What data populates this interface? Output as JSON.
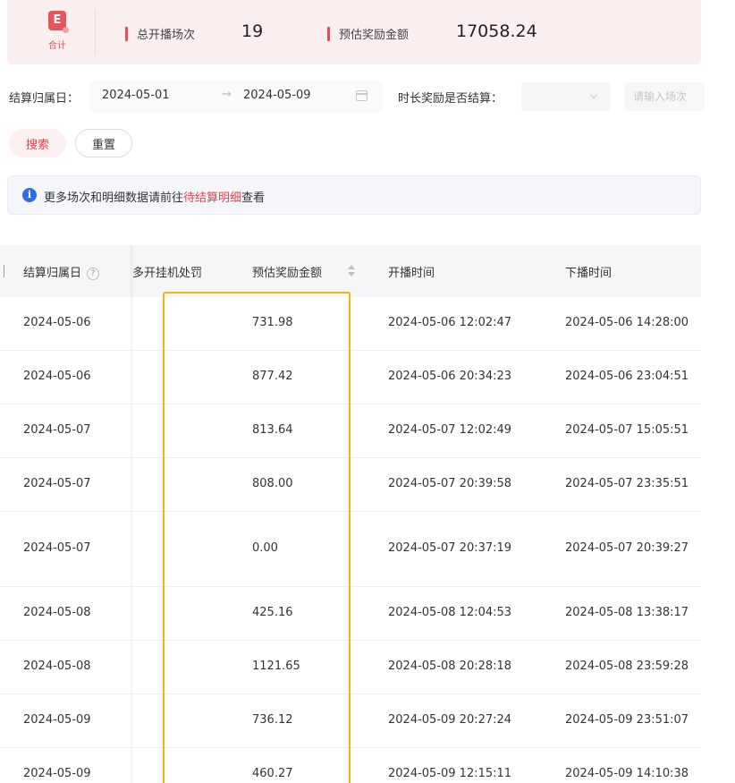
{
  "summary": {
    "badge_label": "合计",
    "total_sessions_label": "总开播场次",
    "total_sessions_value": "19",
    "estimated_reward_label": "预估奖励金额",
    "estimated_reward_value": "17058.24"
  },
  "filter": {
    "date_label": "结算归属日：",
    "start_date": "2024-05-01",
    "end_date": "2024-05-09",
    "duration_label": "时长奖励是否结算：",
    "input_placeholder": "请输入场次"
  },
  "buttons": {
    "search": "搜索",
    "reset": "重置"
  },
  "notice": {
    "text_before": "更多场次和明细数据请前往",
    "link": "待结算明细",
    "text_after": "查看"
  },
  "table": {
    "columns": [
      "结算归属日",
      "多开挂机处罚",
      "预估奖励金额",
      "开播时间",
      "下播时间"
    ],
    "rows": [
      [
        "2024-05-06",
        "",
        "731.98",
        "2024-05-06 12:02:47",
        "2024-05-06 14:28:00"
      ],
      [
        "2024-05-06",
        "",
        "877.42",
        "2024-05-06 20:34:23",
        "2024-05-06 23:04:51"
      ],
      [
        "2024-05-07",
        "",
        "813.64",
        "2024-05-07 12:02:49",
        "2024-05-07 15:05:51"
      ],
      [
        "2024-05-07",
        "",
        "808.00",
        "2024-05-07 20:39:58",
        "2024-05-07 23:35:51"
      ],
      [
        "2024-05-07",
        "",
        "0.00",
        "2024-05-07 20:37:19",
        "2024-05-07 20:39:27"
      ],
      [
        "2024-05-08",
        "",
        "425.16",
        "2024-05-08 12:04:53",
        "2024-05-08 13:38:17"
      ],
      [
        "2024-05-08",
        "",
        "1121.65",
        "2024-05-08 20:28:18",
        "2024-05-08 23:59:28"
      ],
      [
        "2024-05-09",
        "",
        "736.12",
        "2024-05-09 20:27:24",
        "2024-05-09 23:51:07"
      ],
      [
        "2024-05-09",
        "",
        "460.27",
        "2024-05-09 12:15:11",
        "2024-05-09 14:10:38"
      ]
    ]
  },
  "colors": {
    "brand": "#e04e55",
    "highlight": "#f2b21a",
    "info": "#2f6ee0"
  }
}
